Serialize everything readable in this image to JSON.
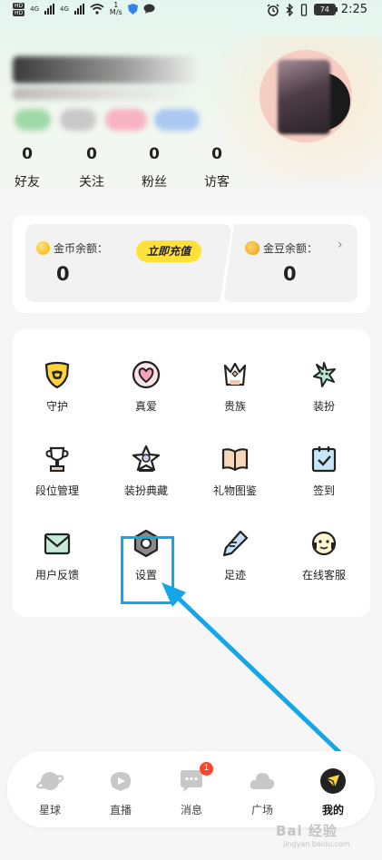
{
  "status_bar": {
    "hd1": "HD",
    "hd2": "HD",
    "net1": "4G",
    "net2": "4G",
    "speed_value": "1",
    "speed_unit": "M/s",
    "battery": "74",
    "time": "2:25"
  },
  "stats": [
    {
      "value": "0",
      "label": "好友"
    },
    {
      "value": "0",
      "label": "关注"
    },
    {
      "value": "0",
      "label": "粉丝"
    },
    {
      "value": "0",
      "label": "访客"
    }
  ],
  "coins": {
    "gold_label": "金币余额：",
    "gold_value": "0",
    "recharge_label": "立即充值",
    "bean_label": "金豆余额：",
    "bean_value": "0",
    "chevron": "›"
  },
  "grid": [
    {
      "label": "守护",
      "icon": "shield-icon"
    },
    {
      "label": "真爱",
      "icon": "heart-icon"
    },
    {
      "label": "贵族",
      "icon": "crown-icon"
    },
    {
      "label": "装扮",
      "icon": "magic-icon"
    },
    {
      "label": "段位管理",
      "icon": "trophy-icon"
    },
    {
      "label": "装扮典藏",
      "icon": "star-icon"
    },
    {
      "label": "礼物图鉴",
      "icon": "book-icon"
    },
    {
      "label": "签到",
      "icon": "checkin-icon"
    },
    {
      "label": "用户反馈",
      "icon": "mail-icon"
    },
    {
      "label": "设置",
      "icon": "settings-icon"
    },
    {
      "label": "足迹",
      "icon": "pen-icon"
    },
    {
      "label": "在线客服",
      "icon": "headset-icon"
    }
  ],
  "nav": [
    {
      "label": "星球",
      "icon": "planet-icon"
    },
    {
      "label": "直播",
      "icon": "live-icon"
    },
    {
      "label": "消息",
      "icon": "message-icon",
      "badge": "1"
    },
    {
      "label": "广场",
      "icon": "square-icon"
    },
    {
      "label": "我的",
      "icon": "profile-icon"
    }
  ],
  "watermark": {
    "text": "Bai 经验",
    "sub": "jingyan.baidu.com"
  },
  "colors": {
    "accent": "#ffe13a",
    "highlight": "#15a6e8",
    "badge": "#f4472e"
  }
}
